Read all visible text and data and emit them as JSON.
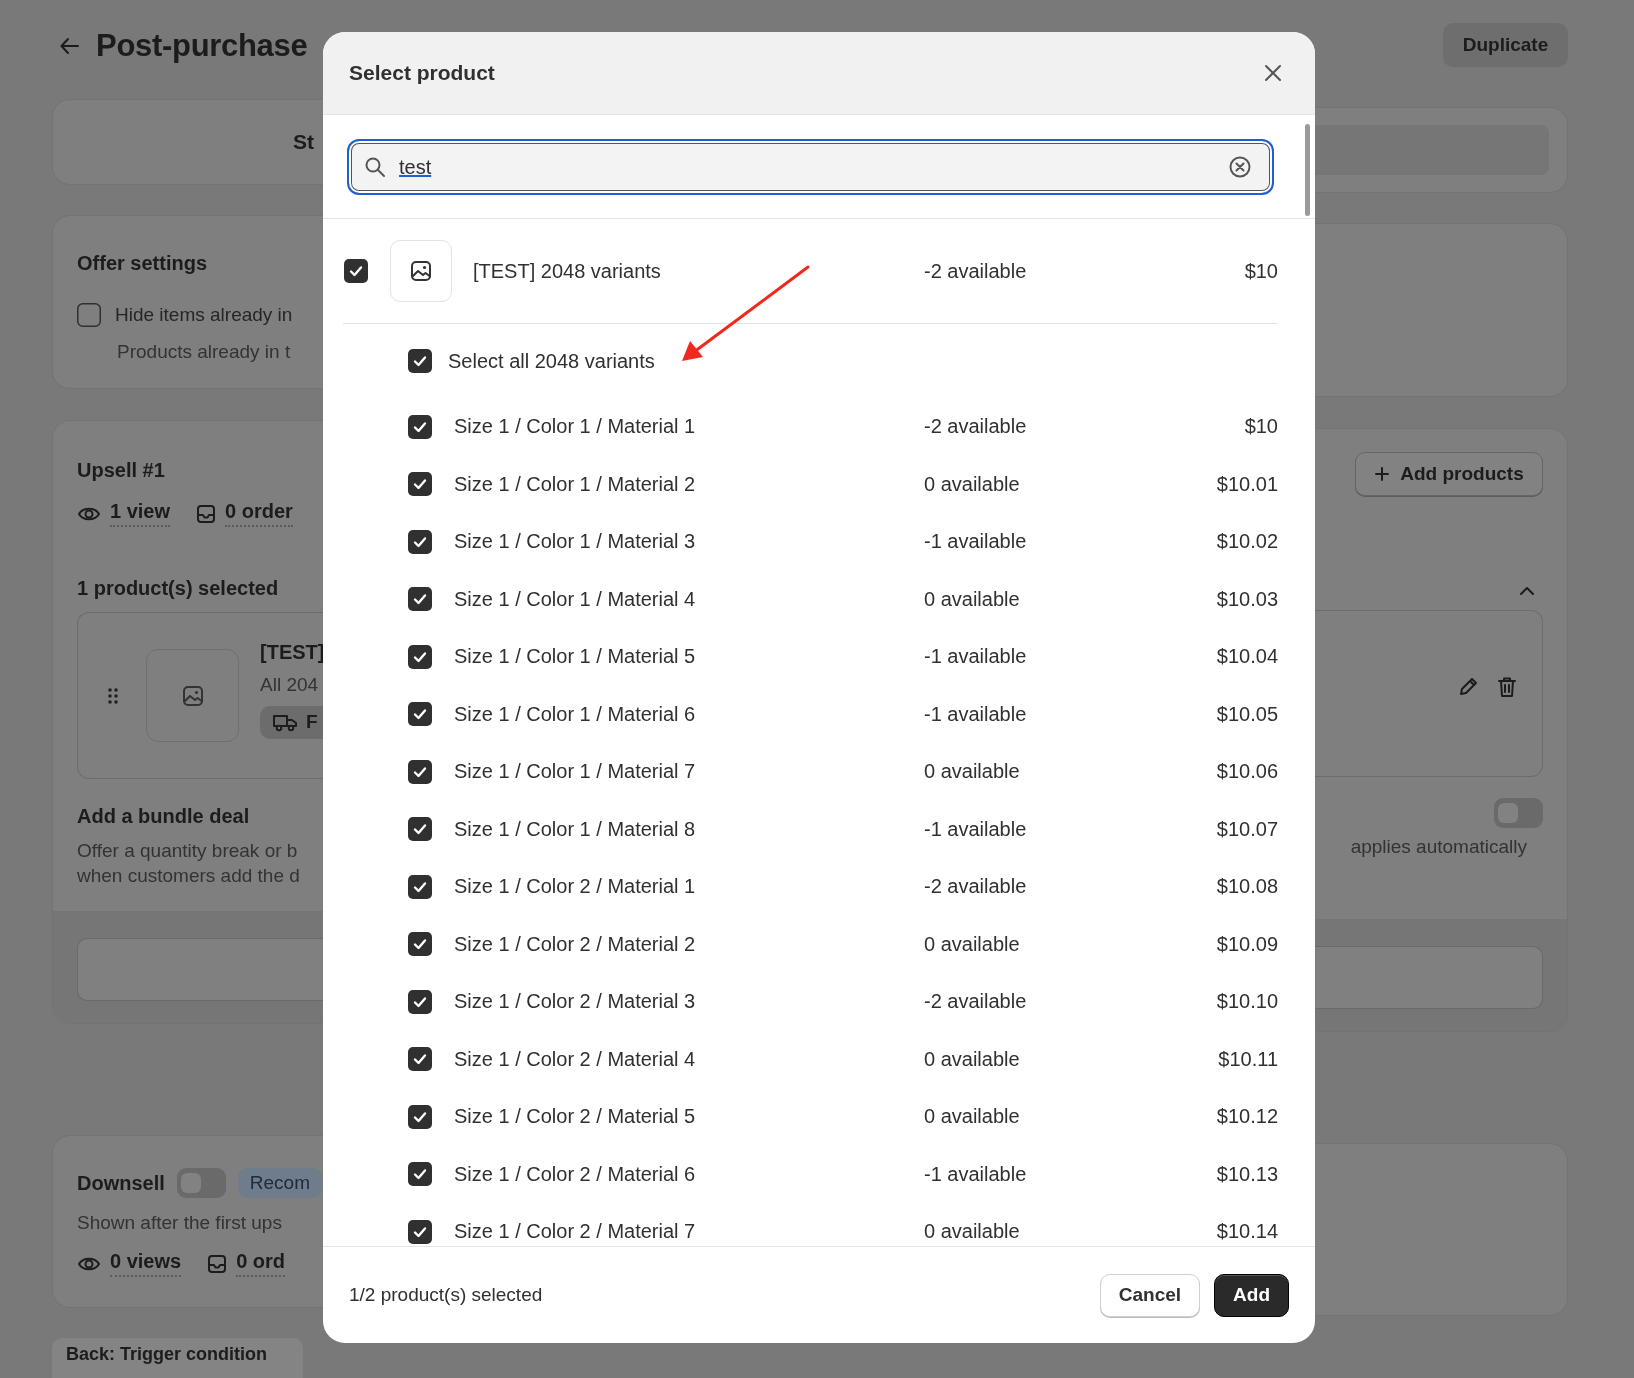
{
  "page": {
    "title": "Post-purchase",
    "duplicate_button": "Duplicate",
    "summary_card": {
      "text": "St"
    },
    "offer_settings": {
      "title": "Offer settings",
      "option": {
        "label": "Hide items already in",
        "checked": false,
        "description": "Products already in t"
      }
    },
    "upsell": {
      "title": "Upsell #1",
      "stats": [
        {
          "kind": "views",
          "value": "1 view"
        },
        {
          "kind": "orders",
          "value": "0 order"
        }
      ],
      "add_button": "Add products",
      "selected_label": "1 product(s) selected",
      "expanded": true,
      "product": {
        "name": "[TEST]",
        "variants": "All 204",
        "badge": "F"
      },
      "bundle": {
        "title": "Add a bundle deal",
        "description_lines": [
          "Offer a quantity break or b",
          "when customers add the d"
        ],
        "note": "applies automatically",
        "on": false
      }
    },
    "downsell": {
      "title": "Downsell",
      "on": false,
      "badge": "Recom",
      "description": "Shown after the first ups",
      "stats": [
        {
          "kind": "views",
          "value": "0 views"
        },
        {
          "kind": "orders",
          "value": "0 ord"
        }
      ]
    },
    "back_button": "Back: Trigger condition"
  },
  "dialog": {
    "title": "Select product",
    "search": {
      "value": "test"
    },
    "product": {
      "checked": true,
      "name": "[TEST] 2048 variants",
      "availability": "-2 available",
      "price": "$10"
    },
    "select_all": {
      "checked": true,
      "label": "Select all 2048 variants"
    },
    "variants": [
      {
        "checked": true,
        "name": "Size 1 / Color 1 / Material 1",
        "availability": "-2 available",
        "price": "$10"
      },
      {
        "checked": true,
        "name": "Size 1 / Color 1 / Material 2",
        "availability": "0 available",
        "price": "$10.01"
      },
      {
        "checked": true,
        "name": "Size 1 / Color 1 / Material 3",
        "availability": "-1 available",
        "price": "$10.02"
      },
      {
        "checked": true,
        "name": "Size 1 / Color 1 / Material 4",
        "availability": "0 available",
        "price": "$10.03"
      },
      {
        "checked": true,
        "name": "Size 1 / Color 1 / Material 5",
        "availability": "-1 available",
        "price": "$10.04"
      },
      {
        "checked": true,
        "name": "Size 1 / Color 1 / Material 6",
        "availability": "-1 available",
        "price": "$10.05"
      },
      {
        "checked": true,
        "name": "Size 1 / Color 1 / Material 7",
        "availability": "0 available",
        "price": "$10.06"
      },
      {
        "checked": true,
        "name": "Size 1 / Color 1 / Material 8",
        "availability": "-1 available",
        "price": "$10.07"
      },
      {
        "checked": true,
        "name": "Size 1 / Color 2 / Material 1",
        "availability": "-2 available",
        "price": "$10.08"
      },
      {
        "checked": true,
        "name": "Size 1 / Color 2 / Material 2",
        "availability": "0 available",
        "price": "$10.09"
      },
      {
        "checked": true,
        "name": "Size 1 / Color 2 / Material 3",
        "availability": "-2 available",
        "price": "$10.10"
      },
      {
        "checked": true,
        "name": "Size 1 / Color 2 / Material 4",
        "availability": "0 available",
        "price": "$10.11"
      },
      {
        "checked": true,
        "name": "Size 1 / Color 2 / Material 5",
        "availability": "0 available",
        "price": "$10.12"
      },
      {
        "checked": true,
        "name": "Size 1 / Color 2 / Material 6",
        "availability": "-1 available",
        "price": "$10.13"
      },
      {
        "checked": true,
        "name": "Size 1 / Color 2 / Material 7",
        "availability": "0 available",
        "price": "$10.14"
      }
    ],
    "footer": {
      "selection_count": "1/2 product(s) selected",
      "buttons": [
        {
          "label": "Cancel",
          "kind": "secondary"
        },
        {
          "label": "Add",
          "kind": "primary"
        }
      ]
    }
  }
}
